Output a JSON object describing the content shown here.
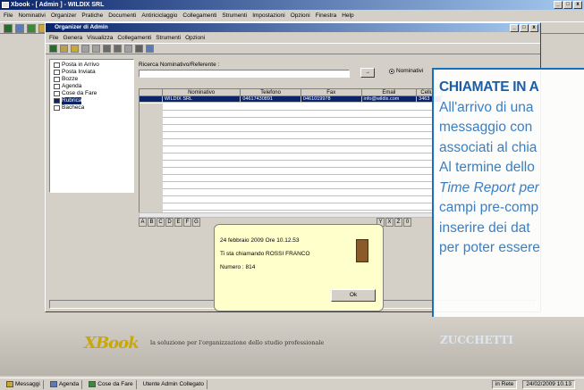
{
  "app": {
    "title": "Xbook - [ Admin ] - WILDIX SRL",
    "window_buttons": [
      "_",
      "□",
      "x"
    ]
  },
  "menu": [
    "File",
    "Nominativi",
    "Organizer",
    "Pratiche",
    "Documenti",
    "Antiriciclaggio",
    "Collegamenti",
    "Strumenti",
    "Impostazioni",
    "Opzioni",
    "Finestra",
    "Help"
  ],
  "organizer": {
    "title": "Organizer di Admin",
    "window_buttons": [
      "_",
      "□",
      "x"
    ],
    "menu": [
      "File",
      "Genera",
      "Visualizza",
      "Collegamenti",
      "Strumenti",
      "Opzioni"
    ],
    "tree": [
      "Posta in Arrivo",
      "Posta Inviata",
      "Bozze",
      "Agenda",
      "Cose da Fare",
      "Rubrica",
      "Bacheca"
    ],
    "search_label": "Ricerca Nominativo/Referente :",
    "search_button": "→",
    "radio_label": "Nominativi",
    "columns": [
      "",
      "Nominativo",
      "Telefono",
      "Fax",
      "Email",
      "Cellula"
    ],
    "rows": [
      [
        "",
        "WILDIX SRL",
        "04617430891",
        "0461019978",
        "info@wildix.com",
        "3463"
      ]
    ],
    "alpha_left": [
      "A",
      "B",
      "C",
      "D",
      "E",
      "F",
      "G"
    ],
    "alpha_right": [
      "Y",
      "X",
      "Z",
      "0"
    ]
  },
  "popup": {
    "datetime": "24 febbraio 2009   Ore 10.12.53",
    "caller": "Ti sta chiamando ROSSI FRANCO",
    "number": "Numero : 814",
    "ok": "Ok"
  },
  "banner": {
    "logo": "XBook",
    "slogan": "la soluzione per l'organizzazione dello studio professionale",
    "brand": "ZUCCHETTI"
  },
  "statusbar": {
    "items": [
      "Messaggi",
      "Agenda",
      "Cose da Fare",
      "Utente Admin Collegato"
    ],
    "net": "in Rete",
    "datetime": "24/02/2009 10.13"
  },
  "callout": {
    "heading": "CHIAMATE IN A",
    "lines": [
      "All'arrivo di una",
      "messaggio con",
      "associati al chia",
      "Al termine dello",
      "Time Report per",
      "campi pre-comp",
      "inserire dei dat",
      "per poter essere"
    ]
  }
}
